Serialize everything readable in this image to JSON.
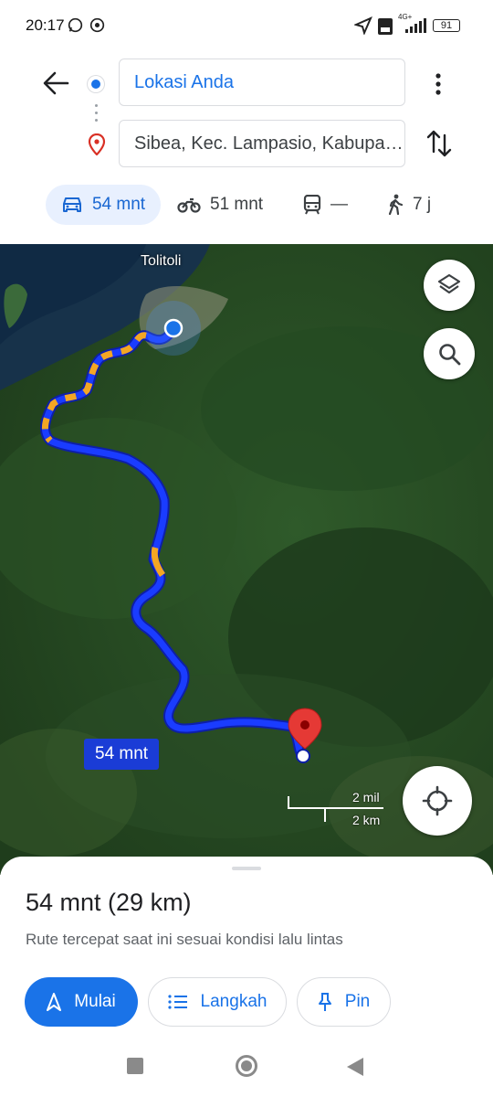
{
  "status_bar": {
    "time": "20:17",
    "battery": "91",
    "network": "4G+"
  },
  "route": {
    "origin": "Lokasi Anda",
    "destination": "Sibea, Kec. Lampasio, Kabupaten Tolitoli"
  },
  "modes": [
    {
      "name": "car",
      "label": "54 mnt",
      "active": true
    },
    {
      "name": "motorcycle",
      "label": "51 mnt"
    },
    {
      "name": "transit",
      "label": "—"
    },
    {
      "name": "walking",
      "label": "7 j"
    }
  ],
  "map": {
    "place_label": "Tolitoli",
    "eta_label": "54 mnt",
    "scale_miles": "2 mil",
    "scale_km": "2 km",
    "route_color": "#1a3cff",
    "traffic_color": "#f4a623",
    "pin_color": "#e53935"
  },
  "sheet": {
    "summary": "54 mnt (29 km)",
    "description": "Rute tercepat saat ini sesuai kondisi lalu lintas",
    "start_label": "Mulai",
    "steps_label": "Langkah",
    "pin_label": "Pin"
  },
  "accent_color": "#1a73e8"
}
